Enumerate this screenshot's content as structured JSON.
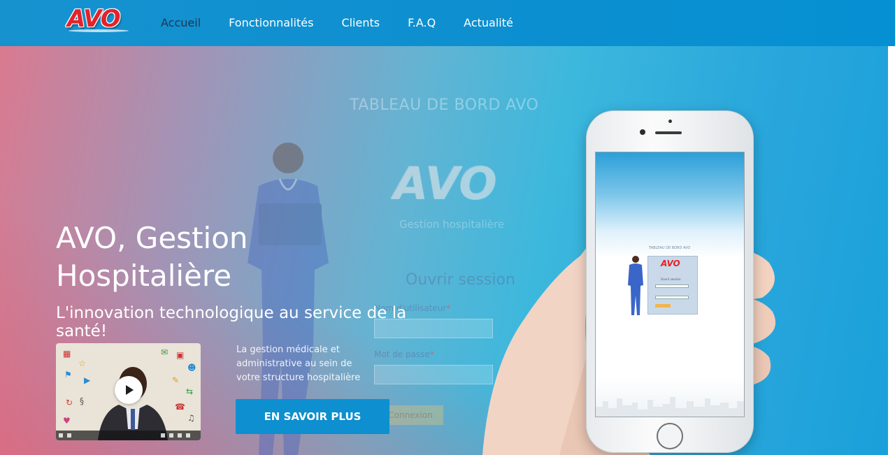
{
  "header": {
    "logo_text": "AVO",
    "nav": [
      {
        "label": "Accueil",
        "active": true
      },
      {
        "label": "Fonctionnalités",
        "active": false
      },
      {
        "label": "Clients",
        "active": false
      },
      {
        "label": "F.A.Q",
        "active": false
      },
      {
        "label": "Actualité",
        "active": false
      }
    ]
  },
  "hero": {
    "title_line1": "AVO, Gestion",
    "title_line2": "Hospitalière",
    "subtitle_line1": "L'innovation technologique au service de la",
    "subtitle_line2": "santé!",
    "description_line1": "La gestion médicale et",
    "description_line2": "administrative au sein de",
    "description_line3": "votre structure hospitalière",
    "cta_label": "EN SAVOIR PLUS"
  },
  "background_dashboard": {
    "title": "TABLEAU DE BORD AVO",
    "logo_text": "AVO",
    "logo_sub": "Gestion hospitalière",
    "login_title": "Ouvrir session",
    "username_label": "Nom d'utilisateur",
    "password_label": "Mot de passe",
    "required_mark": "*",
    "login_button": "Connexion"
  },
  "phone_screen": {
    "title": "TABLEAU DE BORD AVO",
    "logo_text": "AVO",
    "login_title": "Ouvrir session"
  },
  "video": {
    "icon": "play-icon"
  },
  "colors": {
    "header_blue": "#0c8fd0",
    "nav_active": "#1b3556",
    "cta_blue": "#0d8fd0",
    "logo_red": "#e3232b"
  }
}
